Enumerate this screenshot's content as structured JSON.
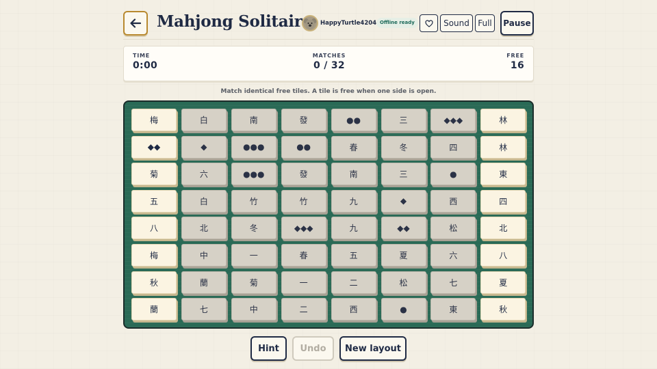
{
  "header": {
    "title": "Mahjong Solitaire",
    "username": "HappyTurtle4204",
    "offline_badge": "Offline ready",
    "sound_label": "Sound",
    "full_label": "Full",
    "pause_label": "Pause",
    "icons": {
      "back": "arrow-left-icon",
      "favorite": "heart-icon",
      "avatar": "koala-avatar"
    }
  },
  "stats": {
    "time_label": "TIME",
    "time_value": "0:00",
    "matches_label": "MATCHES",
    "matches_value": "0 / 32",
    "free_label": "FREE",
    "free_value": "16"
  },
  "instructions": "Match identical free tiles. A tile is free when one side is open.",
  "board": {
    "rows": 8,
    "cols": 8,
    "tiles": [
      [
        "梅",
        "白",
        "南",
        "發",
        "●●",
        "三",
        "◆◆◆",
        "林"
      ],
      [
        "◆◆",
        "◆",
        "●●●",
        "●●",
        "春",
        "冬",
        "四",
        "林"
      ],
      [
        "菊",
        "六",
        "●●●",
        "發",
        "南",
        "三",
        "●",
        "東"
      ],
      [
        "五",
        "白",
        "竹",
        "竹",
        "九",
        "◆",
        "西",
        "四"
      ],
      [
        "八",
        "北",
        "冬",
        "◆◆◆",
        "九",
        "◆◆",
        "松",
        "北"
      ],
      [
        "梅",
        "中",
        "一",
        "春",
        "五",
        "夏",
        "六",
        "八"
      ],
      [
        "秋",
        "蘭",
        "菊",
        "一",
        "二",
        "松",
        "七",
        "夏"
      ],
      [
        "蘭",
        "七",
        "中",
        "二",
        "西",
        "●",
        "東",
        "秋"
      ]
    ],
    "free_columns": [
      0,
      7
    ]
  },
  "actions": {
    "hint_label": "Hint",
    "undo_label": "Undo",
    "new_layout_label": "New layout"
  },
  "colors": {
    "felt": "#2a6a56",
    "free_tile": "#fbf4e2",
    "blocked_tile": "#d6d1c6",
    "ink": "#1f2a44",
    "back_button_border": "#b8892f"
  }
}
